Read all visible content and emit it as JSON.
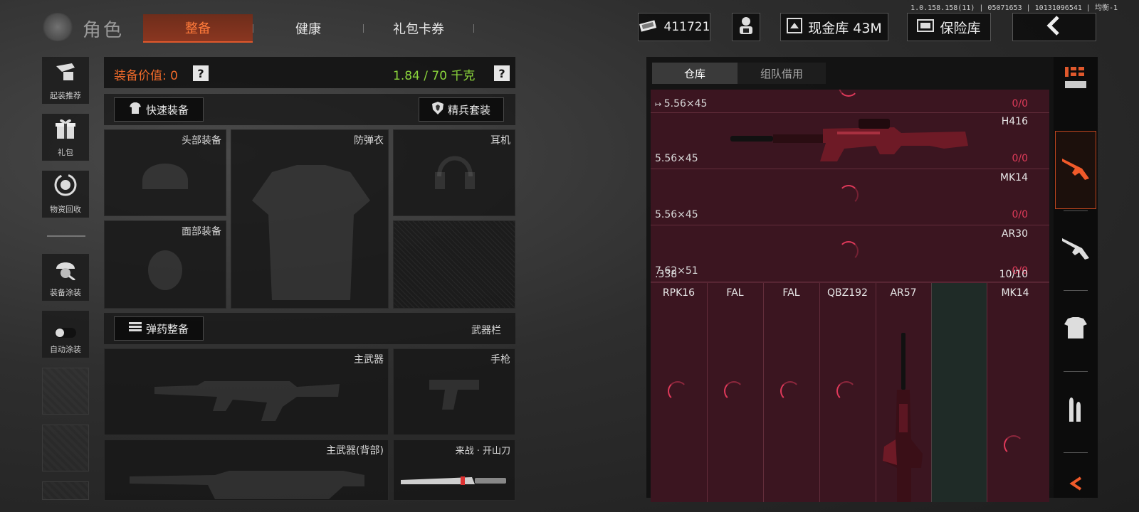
{
  "version_text": "1.0.158.158(11) | 05071653 | 10131096541 | 均衡-1",
  "header": {
    "title": "角色",
    "tabs": [
      {
        "label": "整备",
        "active": true
      },
      {
        "label": "健康",
        "active": false
      },
      {
        "label": "礼包卡券",
        "active": false
      }
    ],
    "currency": "411721",
    "cash_vault": "现金库 43M",
    "safe_box": "保险库"
  },
  "sidebar": {
    "items": [
      {
        "label": "起装推荐",
        "icon": "loadout-recommend-icon"
      },
      {
        "label": "礼包",
        "icon": "gift-icon"
      },
      {
        "label": "物资回收",
        "icon": "recycle-icon"
      },
      {
        "label": "装备涂装",
        "icon": "helmet-skin-icon"
      },
      {
        "label": "自动涂装",
        "icon": "toggle-switch"
      }
    ],
    "auto_skin_enabled": false
  },
  "equipment": {
    "value_label": "装备价值: 0",
    "help": "?",
    "weight": "1.84 / 70 千克",
    "quick_equip": "快速装备",
    "elite_set": "精兵套装",
    "ammo_equip": "弹药整备",
    "weapon_bar": "武器栏",
    "slots": {
      "head": "头部装备",
      "armor": "防弹衣",
      "headset": "耳机",
      "face": "面部装备",
      "primary": "主武器",
      "pistol": "手枪",
      "primary_back": "主武器(背部)",
      "melee": "来战 · 开山刀"
    }
  },
  "inventory": {
    "tabs": [
      {
        "label": "仓库",
        "active": true
      },
      {
        "label": "组队借用",
        "active": false
      }
    ],
    "rows": [
      {
        "caliber": "5.56×45",
        "weapon": "H416",
        "count": "0/0",
        "full": false
      },
      {
        "caliber": "5.56×45",
        "weapon": "MK14",
        "count": "0/0",
        "full": false
      },
      {
        "caliber": "7.62×51",
        "weapon": "AR30",
        "count": "0/0",
        "full": false
      },
      {
        "caliber": ".338",
        "weapon": "",
        "count": "10/10",
        "full": true
      }
    ],
    "first_row_caliber": "5.56×45",
    "first_row_count": "0/0",
    "grid_columns": [
      "RPK16",
      "FAL",
      "FAL",
      "QBZ192",
      "AR57",
      "",
      "MK14"
    ]
  },
  "rail": {
    "items": [
      "storage-icon",
      "assault-rifle-icon",
      "rifle-icon",
      "armor-icon",
      "ammo-icon",
      "collapse-arrow-icon"
    ],
    "active_index": 1
  },
  "colors": {
    "accent": "#f06a2a",
    "weight_green": "#8bd53c",
    "warning_red": "#e03b5a",
    "inventory_bg": "#3b1520"
  }
}
